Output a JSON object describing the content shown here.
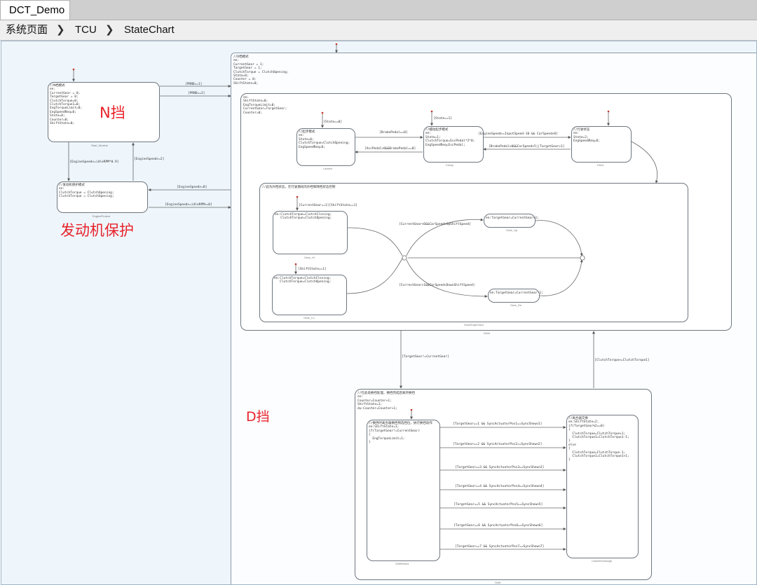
{
  "tab": {
    "title": "DCT_Demo"
  },
  "breadcrumb": [
    "系统页面",
    "TCU",
    "StateChart"
  ],
  "annotations": {
    "n_gear": "N挡",
    "engine_protect": "发动机保护",
    "d_gear": "D挡"
  },
  "states": {
    "n_mode": {
      "code": "//N档模式\nen:\nCurrentGear = 0;\nTargetGear = 0;\nClutchTorque=0;\nClutchTorque1=0;\nEngTorqueLimit=0;\nEngSpeedReq=0;\nState=0;\nCounter=0;\nShiftState=0;",
      "name": "Start_Neutral"
    },
    "engine_protect": {
      "code": "//发动机保护模式\nen:\nClutchTorque = ClutchOpening;\nClutchTorque = ClutchOpening;",
      "name": "EngineProtect"
    },
    "d_mode_outer": {
      "code": "//D档模式\nen:\nCurrentGear = 1;\nTargetGear = 1;\nClutchTorque = ClutchOpening;\nState=0;\nCounter = 0;\nShiftState=0;"
    },
    "drive_inner": {
      "code": "en:\nShiftState=0;\nEngTorqueLimit=0;\nCurrentGear=TargetGear;\nCounter=0;",
      "name": "Drive"
    },
    "launch": {
      "code": "//起步模式\nen:\nState=0;\nClutchTorque=ClutchOpening;\nEngSpeedReq=0;",
      "name": "Launch"
    },
    "creep": {
      "code": "//蠕动起步模式\nen:\nState=1;\nClutchTorque=EscPedal*2*0;\nEngSpeedReq=EscPedal;",
      "name": "Creep"
    },
    "drive_state": {
      "code": "//行驶状态\nen:\nState=2;\nEngSpeedReq=0;",
      "name": "Drive"
    },
    "gear_region": {
      "code": "//此为升档状态，在行驶期间的升档和降档状态控制",
      "name": "GearSupervisor"
    },
    "upshift_a": {
      "code": "en:ClutchTorque=ClutchClosing;\n   ClutchTorque=ClutchOpening;",
      "name": "Gear_Hi"
    },
    "upshift_b": {
      "code": "en:ClutchTorque=ClutchClosing;\n   ClutchTorque=ClutchOpening;",
      "name": "Gear_Lo"
    },
    "gear_up_target": {
      "code": "en:TargetGear=CurrentGear+1;",
      "name": "Gear_Up"
    },
    "gear_down_target": {
      "code": "en:TargetGear=CurrentGear-1;",
      "name": "Gear_Dn"
    },
    "shift_region": {
      "code": "//在此处换挡处理，换挡完成后离开换挡\nen:\nCounter=Counter+1;\nShiftState=1;\ndu:Counter=Counter+1;",
      "name": "Shift"
    },
    "shift_select": {
      "code": "//换挡时离合器换挡预选挡位，执行换挡动作\nen:ShiftState=1;\nif(TargetGear!=CurrentGear)\n{\n  EngTorqueLimit=1;\n}",
      "name": "ShiftSelect"
    },
    "clutch_exchange": {
      "code": "//离合器交换\nen:ShiftState=2;\nif(TargetGear%2==0)\n{\n  ClutchTorque=ClutchTorque+1;\n  ClutchTorque1=ClutchTorque1-1;\n}\nelse\n{\n  ClutchTorque=ClutchTorque-1;\n  ClutchTorque1=ClutchTorque1+1;\n}",
      "name": "ClutchExchange"
    }
  },
  "transitions": {
    "n_to_d_1": "[PRND==1]",
    "n_to_d_2": "[PRND==2]",
    "n_to_protect": "[EngineSpeed<=idleRPM*0.9]",
    "protect_to_n": "[EngineSpeed>=2]",
    "protect_to_d_1": "[EngineSpeed>=0]",
    "protect_to_d_2": "[EngineSpeed>=idleRPM>=0]",
    "drive_default_state": "[State==0]",
    "launch_to_creep_1": "[BrakePedal==0]",
    "launch_to_creep_2": "[AccPedal>0&&BrakePedal==0]",
    "creep_default": "[State==1]",
    "creep_to_drive": "[EngineSpeed>=InputSpeed-10 && CarSpeed>0]",
    "drive_to_creep": "[BrakePedal>0&&CarSpeed<5||TargetGear>1]",
    "drive_default": "[State==2]",
    "gear_default_a": "[CurrentGear==1][ShiftState==1]",
    "gear_default_b": "[ShiftState==1]",
    "gear_upshift": "[CurrentGear<6&&CarSpeed>UpShiftSpeed]",
    "gear_downshift": "[CurrentGear>1&&CarSpeed<DownShiftSpeed]",
    "to_shift": "[TargetGear!=CurrentGear]",
    "from_shift": "[ClutchTorque>=ClutchTorque1]",
    "sel_1": "[TargetGear==1 && SyncActuatorPos1==SyncShown1]",
    "sel_2": "[TargetGear==2 && SyncActuatorPos2==SyncShown2]",
    "sel_3": "[TargetGear==3 && SyncActuatorPos3==SyncShown3]",
    "sel_4": "[TargetGear==4 && SyncActuatorPos4==SyncShown4]",
    "sel_5": "[TargetGear==5 && SyncActuatorPos5==SyncShown5]",
    "sel_6": "[TargetGear==6 && SyncActuatorPos6==SyncShown6]",
    "sel_7": "[TargetGear==7 && SyncActuatorPos7==SyncShown7]"
  },
  "colors": {
    "annotation": "#e8232b",
    "canvas": "#eef6fc",
    "comment": "#2a8a2a"
  }
}
